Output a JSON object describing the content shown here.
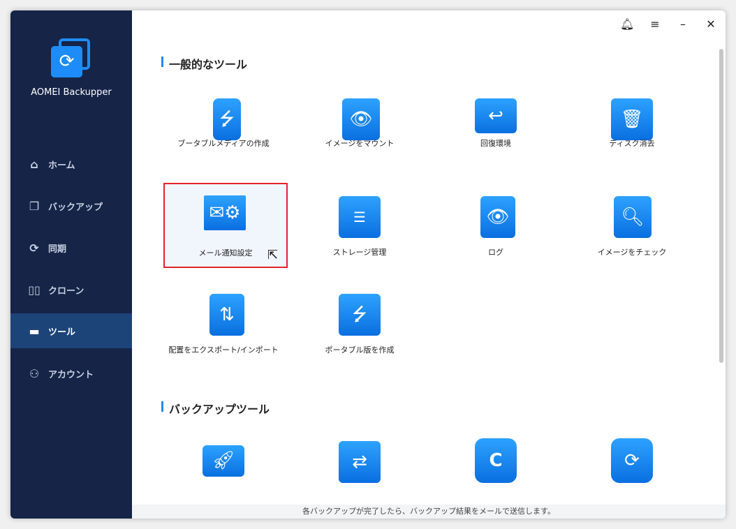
{
  "app": {
    "name": "AOMEI Backupper"
  },
  "nav": [
    {
      "label": "ホーム",
      "icon": "home-icon"
    },
    {
      "label": "バックアップ",
      "icon": "backup-icon"
    },
    {
      "label": "同期",
      "icon": "sync-icon"
    },
    {
      "label": "クローン",
      "icon": "clone-icon"
    },
    {
      "label": "ツール",
      "icon": "tools-icon",
      "active": true
    },
    {
      "label": "アカウント",
      "icon": "account-icon"
    }
  ],
  "sections": {
    "general": "一般的なツール",
    "backup": "バックアップツール"
  },
  "tools": [
    {
      "label": "ブータブルメディアの作成",
      "icon": "usb-icon"
    },
    {
      "label": "イメージをマウント",
      "icon": "mount-image-icon"
    },
    {
      "label": "回復環境",
      "icon": "recovery-env-icon"
    },
    {
      "label": "ディスク消去",
      "icon": "disk-wipe-icon"
    },
    {
      "label": "メール通知設定",
      "icon": "mail-settings-icon"
    },
    {
      "label": "ストレージ管理",
      "icon": "storage-icon"
    },
    {
      "label": "ログ",
      "icon": "log-icon"
    },
    {
      "label": "イメージをチェック",
      "icon": "check-image-icon"
    },
    {
      "label": "配置をエクスポート/インポート",
      "icon": "export-import-icon"
    },
    {
      "label": "ポータブル版を作成",
      "icon": "portable-icon"
    }
  ],
  "status": "各バックアップが完了したら、バックアップ結果をメールで送信します。"
}
